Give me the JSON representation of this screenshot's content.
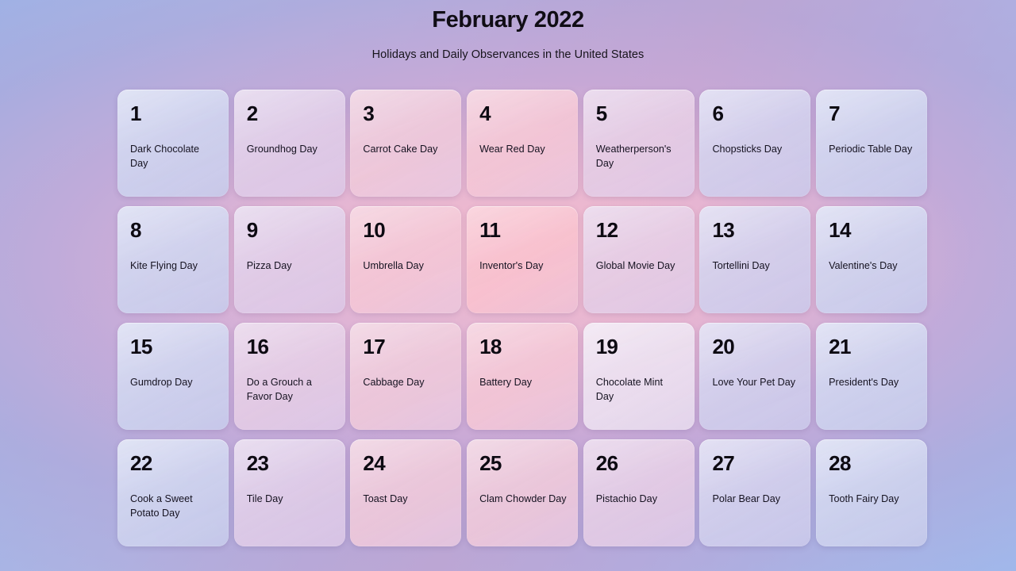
{
  "header": {
    "title": "February 2022",
    "subtitle": "Holidays and Daily Observances in the United States"
  },
  "theme": {
    "background_edge": "#9ab4e8",
    "background_center": "#f0bace",
    "background_mid": "#bda8d6",
    "text_color": "#100d15",
    "cell_shadow": "rgba(83,64,120,0.17)"
  },
  "calendar": {
    "month": "February",
    "year": "2022",
    "columns": 7,
    "rows": 4,
    "highlighted_day": "19",
    "days": [
      {
        "day": "1",
        "event": "Dark Chocolate Day",
        "tint": "b-1",
        "highlight": false
      },
      {
        "day": "2",
        "event": "Groundhog Day",
        "tint": "p-1",
        "highlight": false
      },
      {
        "day": "3",
        "event": "Carrot Cake Day",
        "tint": "p-3",
        "highlight": false
      },
      {
        "day": "4",
        "event": "Wear Red Day",
        "tint": "p-4",
        "highlight": false
      },
      {
        "day": "5",
        "event": "Weatherperson's Day",
        "tint": "p-2",
        "highlight": false
      },
      {
        "day": "6",
        "event": "Chopsticks Day",
        "tint": "b-2",
        "highlight": false
      },
      {
        "day": "7",
        "event": "Periodic Table Day",
        "tint": "b-1",
        "highlight": false
      },
      {
        "day": "8",
        "event": "Kite Flying Day",
        "tint": "b-1",
        "highlight": false
      },
      {
        "day": "9",
        "event": "Pizza Day",
        "tint": "p-1",
        "highlight": false
      },
      {
        "day": "10",
        "event": "Umbrella Day",
        "tint": "p-4",
        "highlight": false
      },
      {
        "day": "11",
        "event": "Inventor's Day",
        "tint": "p-5",
        "highlight": false
      },
      {
        "day": "12",
        "event": "Global Movie Day",
        "tint": "p-2",
        "highlight": false
      },
      {
        "day": "13",
        "event": "Tortellini Day",
        "tint": "b-2",
        "highlight": false
      },
      {
        "day": "14",
        "event": "Valentine's Day",
        "tint": "b-1",
        "highlight": false
      },
      {
        "day": "15",
        "event": "Gumdrop Day",
        "tint": "b-1",
        "highlight": false
      },
      {
        "day": "16",
        "event": "Do a Grouch a Favor Day",
        "tint": "p-2",
        "highlight": false
      },
      {
        "day": "17",
        "event": "Cabbage Day",
        "tint": "p-3",
        "highlight": false
      },
      {
        "day": "18",
        "event": "Battery Day",
        "tint": "p-4",
        "highlight": false
      },
      {
        "day": "19",
        "event": "Chocolate Mint Day",
        "tint": "hl",
        "highlight": true
      },
      {
        "day": "20",
        "event": "Love Your Pet Day",
        "tint": "b-2",
        "highlight": false
      },
      {
        "day": "21",
        "event": "President's Day",
        "tint": "b-1",
        "highlight": false
      },
      {
        "day": "22",
        "event": "Cook a Sweet Potato Day",
        "tint": "b-1",
        "highlight": false
      },
      {
        "day": "23",
        "event": "Tile Day",
        "tint": "p-1",
        "highlight": false
      },
      {
        "day": "24",
        "event": "Toast Day",
        "tint": "p-3",
        "highlight": false
      },
      {
        "day": "25",
        "event": "Clam Chowder Day",
        "tint": "p-3",
        "highlight": false
      },
      {
        "day": "26",
        "event": "Pistachio Day",
        "tint": "p-2",
        "highlight": false
      },
      {
        "day": "27",
        "event": "Polar Bear Day",
        "tint": "b-2",
        "highlight": false
      },
      {
        "day": "28",
        "event": "Tooth Fairy Day",
        "tint": "b-1",
        "highlight": false
      }
    ]
  }
}
